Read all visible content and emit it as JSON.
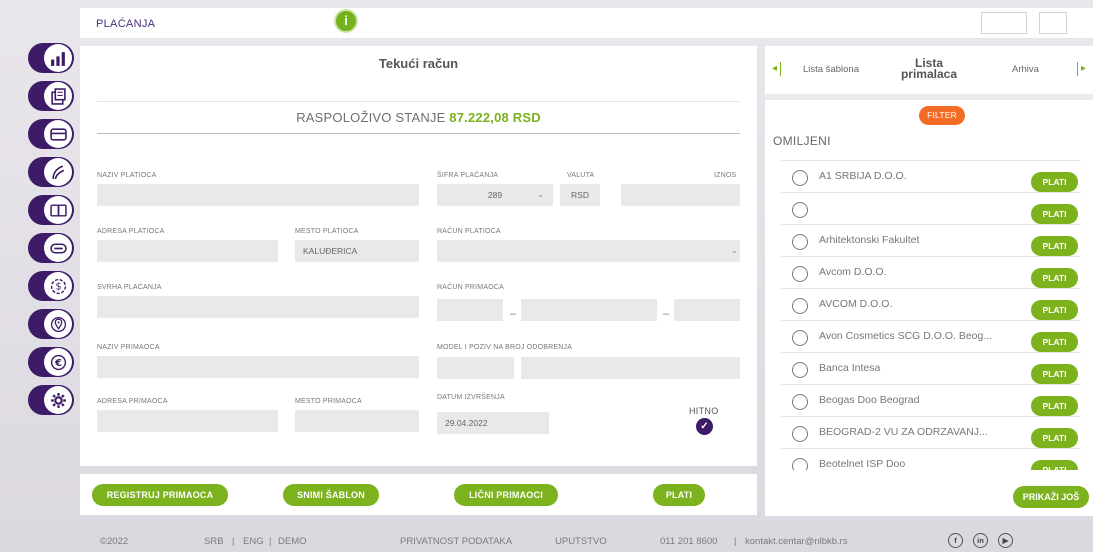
{
  "topbar": {
    "title": "PLAĆANJA",
    "info_icon": "info-icon"
  },
  "nav": [
    {
      "icon": "bar-chart-icon"
    },
    {
      "icon": "document-stack-icon"
    },
    {
      "icon": "card-icon"
    },
    {
      "icon": "hand-money-icon"
    },
    {
      "icon": "exchange-cards-icon"
    },
    {
      "icon": "minus-card-icon"
    },
    {
      "icon": "dollar-refresh-icon"
    },
    {
      "icon": "location-pin-icon"
    },
    {
      "icon": "euro-exchange-icon"
    },
    {
      "icon": "gear-icon"
    }
  ],
  "form": {
    "title": "Tekući račun",
    "balance_label": "RASPOLOŽIVO STANJE",
    "balance_value": "87.222,08 RSD",
    "naziv_platioca_label": "NAZIV PLATIOCA",
    "sifra_placanja_label": "ŠIFRA PLAĆANJA",
    "sifra_placanja_value": "289",
    "valuta_label": "VALUTA",
    "valuta_value": "RSD",
    "iznos_label": "IZNOS",
    "adresa_platioca_label": "ADRESA PLATIOCA",
    "mesto_platioca_label": "MESTO PLATIOCA",
    "mesto_platioca_value": "KALUĐERICA",
    "racun_platioca_label": "RAČUN PLATIOCA",
    "svrha_placanja_label": "SVRHA PLAĆANJA",
    "racun_primaoca_label": "RAČUN PRIMAOCA",
    "naziv_primaoca_label": "NAZIV PRIMAOCA",
    "model_label": "MODEL I POZIV NA BROJ ODOBRENJA",
    "adresa_primaoca_label": "ADRESA PRIMAOCA",
    "mesto_primaoca_label": "MESTO PRIMAOCA",
    "datum_label": "DATUM IZVRŠENJA",
    "datum_value": "29.04.2022",
    "hitno_label": "HITNO",
    "hitno_checked": true
  },
  "actions": {
    "registruj": "REGISTRUJ PRIMAOCA",
    "snimi": "SNIMI ŠABLON",
    "licni": "LIČNI PRIMAOCI",
    "plati": "PLATI"
  },
  "right_panel": {
    "tab_left": "Lista šablona",
    "tab_active_line1": "Lista",
    "tab_active_line2": "primalaca",
    "tab_right": "Arhiva",
    "filter": "FILTER",
    "section": "OMILJENI",
    "plati_label": "PLATI",
    "show_more": "PRIKAŽI JOŠ",
    "recipients": [
      "A1 SRBIJA D.O.O.",
      "",
      "Arhitektonski Fakultet",
      "Avcom D.O.O.",
      "AVCOM D.O.O.",
      "Avon Cosmetics SCG D.O.O. Beog...",
      "Banca Intesa",
      "Beogas Doo Beograd",
      "BEOGRAD-2 VU ZA ODRZAVANJ...",
      "Beotelnet ISP Doo"
    ]
  },
  "footer": {
    "copyright": "©2022",
    "lang_srb": "SRB",
    "lang_eng": "ENG",
    "lang_demo": "DEMO",
    "sep": "|",
    "privacy": "PRIVATNOST PODATAKA",
    "manual": "UPUTSTVO",
    "phone": "011 201 8600",
    "email": "kontakt.centar@nlbkb.rs",
    "social": [
      "facebook-icon",
      "linkedin-icon",
      "youtube-icon"
    ]
  },
  "colors": {
    "brand_purple": "#3d1b66",
    "accent_green": "#7bb21e",
    "filter_orange": "#f36b24"
  }
}
